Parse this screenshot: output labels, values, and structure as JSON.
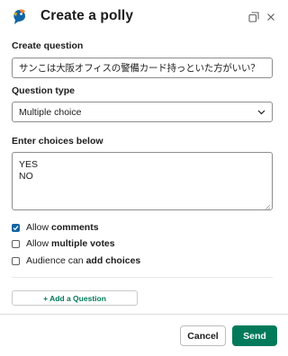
{
  "header": {
    "title": "Create a polly",
    "logo_icon": "polly-bird-icon",
    "popout_icon": "popout-icon",
    "close_icon": "close-icon"
  },
  "form": {
    "question_label": "Create question",
    "question_value": "サンこは大阪オフィスの警備カード持っといた方がいい？",
    "type_label": "Question type",
    "type_value": "Multiple choice",
    "choices_label": "Enter choices below",
    "choices": [
      "YES",
      "NO"
    ]
  },
  "options": [
    {
      "prefix": "Allow ",
      "bold": "comments",
      "checked": true
    },
    {
      "prefix": "Allow ",
      "bold": "multiple votes",
      "checked": false
    },
    {
      "prefix": "Audience can ",
      "bold": "add choices",
      "checked": false
    }
  ],
  "buttons": {
    "add_question": "+ Add a Question",
    "cancel": "Cancel",
    "send": "Send"
  },
  "colors": {
    "accent_green": "#007a5a",
    "checkbox_blue": "#1264a3",
    "logo_orange": "#f0812d",
    "logo_blue": "#1264a3"
  }
}
